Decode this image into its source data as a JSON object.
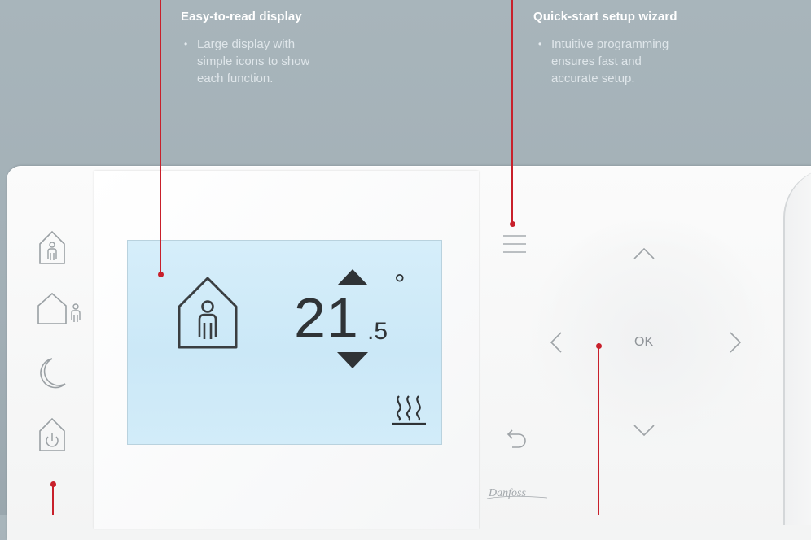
{
  "callouts": {
    "display": {
      "title": "Easy-to-read display",
      "bullet": "Large display with simple icons to show each function.",
      "lines": [
        "Large display with",
        "simple icons to show",
        "each function."
      ]
    },
    "wizard": {
      "title": "Quick-start setup wizard",
      "bullet": "Intuitive programming ensures fast and accurate setup.",
      "lines": [
        "Intuitive programming",
        "ensures fast and",
        "accurate setup."
      ]
    }
  },
  "lcd": {
    "mode_icon": "home-person-icon",
    "temperature_whole": "21",
    "temperature_decimal": ".5",
    "unit_symbol": "°",
    "heating_icon": "heating-waves-icon"
  },
  "side_buttons": [
    {
      "name": "home-mode-icon"
    },
    {
      "name": "away-mode-icon"
    },
    {
      "name": "night-mode-icon"
    },
    {
      "name": "standby-power-icon"
    }
  ],
  "navigation": {
    "ok_label": "OK",
    "menu_icon": "menu-icon",
    "back_icon": "back-arrow-icon"
  },
  "brand": {
    "logo_text": "Danfoss"
  },
  "colors": {
    "background": "#a4b1b8",
    "accent_line": "#c8202b",
    "lcd": "#d2ecf9",
    "device": "#f7f7f7"
  }
}
